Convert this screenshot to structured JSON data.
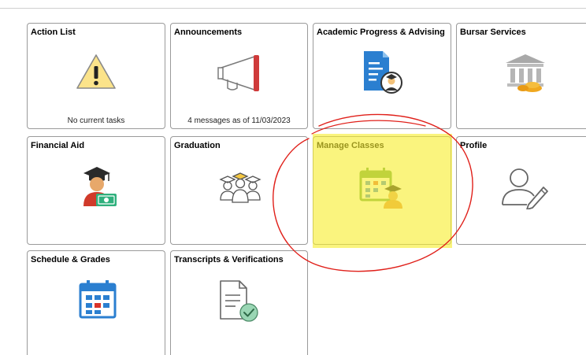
{
  "tiles": [
    {
      "title": "Action List",
      "status": "No current tasks",
      "icon": "warning-icon"
    },
    {
      "title": "Announcements",
      "status": "4 messages as of 11/03/2023",
      "icon": "megaphone-icon"
    },
    {
      "title": "Academic Progress & Advising",
      "status": "",
      "icon": "document-graduate-icon"
    },
    {
      "title": "Bursar Services",
      "status": "",
      "icon": "bank-coins-icon"
    },
    {
      "title": "Financial Aid",
      "status": "",
      "icon": "graduate-money-icon"
    },
    {
      "title": "Graduation",
      "status": "",
      "icon": "graduates-group-icon"
    },
    {
      "title": "Manage Classes",
      "status": "",
      "icon": "calendar-student-icon"
    },
    {
      "title": "Profile",
      "status": "",
      "icon": "person-edit-icon"
    },
    {
      "title": "Schedule & Grades",
      "status": "",
      "icon": "calendar-icon"
    },
    {
      "title": "Transcripts & Verifications",
      "status": "",
      "icon": "document-check-icon"
    }
  ],
  "annotations": {
    "highlight_color": "#f7ee2e",
    "circle_color": "#e0201a",
    "highlighted_tile": "Manage Classes"
  }
}
